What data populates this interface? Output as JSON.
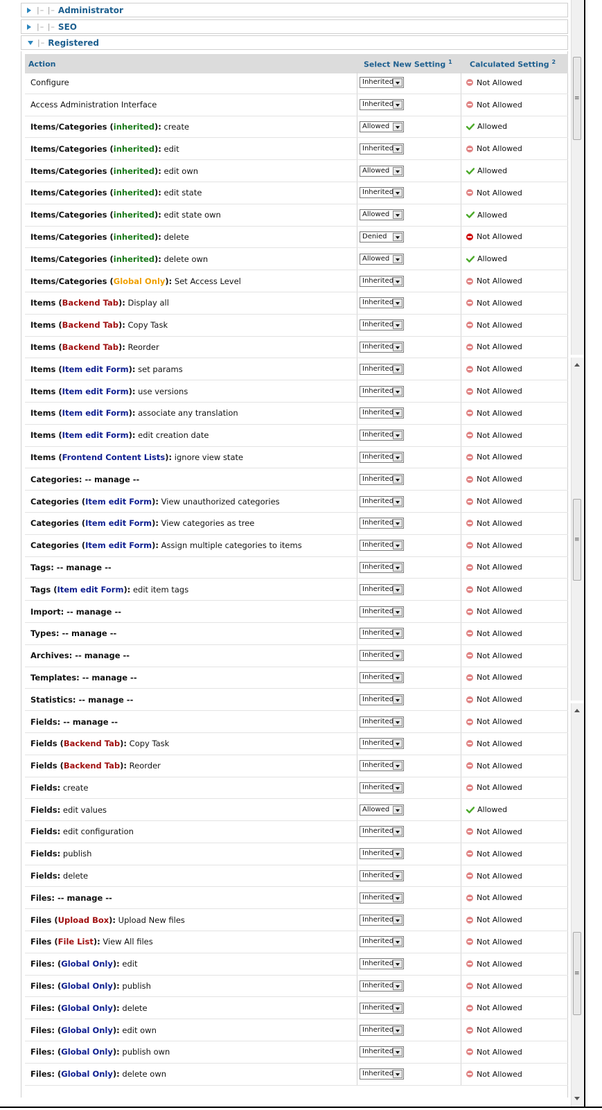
{
  "groups": {
    "administrator": "Administrator",
    "seo": "SEO",
    "registered": "Registered",
    "tree_prefix": "|– |–",
    "tree_prefix_registered": "|–"
  },
  "table": {
    "col_action": "Action",
    "col_select": "Select New Setting",
    "col_select_sup": "1",
    "col_calc": "Calculated Setting",
    "col_calc_sup": "2"
  },
  "rows": [
    {
      "pre": "Configure",
      "bold": false,
      "tag": "",
      "tagc": "",
      "post": "",
      "sel": "Inherited",
      "calc": "Not Allowed"
    },
    {
      "pre": "Access Administration Interface",
      "bold": false,
      "tag": "",
      "tagc": "",
      "post": "",
      "sel": "Inherited",
      "calc": "Not Allowed"
    },
    {
      "pre": "Items/Categories",
      "bold": true,
      "tag": "inherited",
      "tagc": "green",
      "post": ": create",
      "sel": "Allowed",
      "calc": "Allowed"
    },
    {
      "pre": "Items/Categories",
      "bold": true,
      "tag": "inherited",
      "tagc": "green",
      "post": ": edit",
      "sel": "Inherited",
      "calc": "Not Allowed"
    },
    {
      "pre": "Items/Categories",
      "bold": true,
      "tag": "inherited",
      "tagc": "green",
      "post": ": edit own",
      "sel": "Allowed",
      "calc": "Allowed"
    },
    {
      "pre": "Items/Categories",
      "bold": true,
      "tag": "inherited",
      "tagc": "green",
      "post": ": edit state",
      "sel": "Inherited",
      "calc": "Not Allowed"
    },
    {
      "pre": "Items/Categories",
      "bold": true,
      "tag": "inherited",
      "tagc": "green",
      "post": ": edit state own",
      "sel": "Allowed",
      "calc": "Allowed"
    },
    {
      "pre": "Items/Categories",
      "bold": true,
      "tag": "inherited",
      "tagc": "green",
      "post": ": delete",
      "sel": "Denied",
      "calc": "Not Allowed",
      "strong": true
    },
    {
      "pre": "Items/Categories",
      "bold": true,
      "tag": "inherited",
      "tagc": "green",
      "post": ": delete own",
      "sel": "Allowed",
      "calc": "Allowed"
    },
    {
      "pre": "Items/Categories",
      "bold": true,
      "tag": "Global Only",
      "tagc": "orange",
      "post": ": Set Access Level",
      "sel": "Inherited",
      "calc": "Not Allowed"
    },
    {
      "pre": "Items",
      "bold": true,
      "tag": "Backend Tab",
      "tagc": "red",
      "post": ": Display all",
      "sel": "Inherited",
      "calc": "Not Allowed"
    },
    {
      "pre": "Items",
      "bold": true,
      "tag": "Backend Tab",
      "tagc": "red",
      "post": ": Copy Task",
      "sel": "Inherited",
      "calc": "Not Allowed"
    },
    {
      "pre": "Items",
      "bold": true,
      "tag": "Backend Tab",
      "tagc": "red",
      "post": ": Reorder",
      "sel": "Inherited",
      "calc": "Not Allowed"
    },
    {
      "pre": "Items",
      "bold": true,
      "tag": "Item edit Form",
      "tagc": "blue",
      "post": ": set params",
      "sel": "Inherited",
      "calc": "Not Allowed"
    },
    {
      "pre": "Items",
      "bold": true,
      "tag": "Item edit Form",
      "tagc": "blue",
      "post": ": use versions",
      "sel": "Inherited",
      "calc": "Not Allowed"
    },
    {
      "pre": "Items",
      "bold": true,
      "tag": "Item edit Form",
      "tagc": "blue",
      "post": ": associate any translation",
      "sel": "Inherited",
      "calc": "Not Allowed"
    },
    {
      "pre": "Items",
      "bold": true,
      "tag": "Item edit Form",
      "tagc": "blue",
      "post": ": edit creation date",
      "sel": "Inherited",
      "calc": "Not Allowed"
    },
    {
      "pre": "Items",
      "bold": true,
      "tag": "Frontend Content Lists",
      "tagc": "blue",
      "post": ": ignore view state",
      "sel": "Inherited",
      "calc": "Not Allowed"
    },
    {
      "pre": "Categories: -- manage --",
      "bold": true,
      "tag": "",
      "tagc": "",
      "post": "",
      "sel": "Inherited",
      "calc": "Not Allowed"
    },
    {
      "pre": "Categories",
      "bold": true,
      "tag": "Item edit Form",
      "tagc": "blue",
      "post": ": View unauthorized categories",
      "sel": "Inherited",
      "calc": "Not Allowed"
    },
    {
      "pre": "Categories",
      "bold": true,
      "tag": "Item edit Form",
      "tagc": "blue",
      "post": ": View categories as tree",
      "sel": "Inherited",
      "calc": "Not Allowed"
    },
    {
      "pre": "Categories",
      "bold": true,
      "tag": "Item edit Form",
      "tagc": "blue",
      "post": ": Assign multiple categories to items",
      "sel": "Inherited",
      "calc": "Not Allowed"
    },
    {
      "pre": "Tags: -- manage --",
      "bold": true,
      "tag": "",
      "tagc": "",
      "post": "",
      "sel": "Inherited",
      "calc": "Not Allowed"
    },
    {
      "pre": "Tags",
      "bold": true,
      "tag": "Item edit Form",
      "tagc": "blue",
      "post": ": edit item tags",
      "sel": "Inherited",
      "calc": "Not Allowed"
    },
    {
      "pre": "Import: -- manage --",
      "bold": true,
      "tag": "",
      "tagc": "",
      "post": "",
      "sel": "Inherited",
      "calc": "Not Allowed"
    },
    {
      "pre": "Types: -- manage --",
      "bold": true,
      "tag": "",
      "tagc": "",
      "post": "",
      "sel": "Inherited",
      "calc": "Not Allowed"
    },
    {
      "pre": "Archives: -- manage --",
      "bold": true,
      "tag": "",
      "tagc": "",
      "post": "",
      "sel": "Inherited",
      "calc": "Not Allowed"
    },
    {
      "pre": "Templates: -- manage --",
      "bold": true,
      "tag": "",
      "tagc": "",
      "post": "",
      "sel": "Inherited",
      "calc": "Not Allowed"
    },
    {
      "pre": "Statistics: -- manage --",
      "bold": true,
      "tag": "",
      "tagc": "",
      "post": "",
      "sel": "Inherited",
      "calc": "Not Allowed"
    },
    {
      "pre": "Fields: -- manage --",
      "bold": true,
      "tag": "",
      "tagc": "",
      "post": "",
      "sel": "Inherited",
      "calc": "Not Allowed"
    },
    {
      "pre": "Fields",
      "bold": true,
      "tag": "Backend Tab",
      "tagc": "red",
      "post": ": Copy Task",
      "sel": "Inherited",
      "calc": "Not Allowed"
    },
    {
      "pre": "Fields",
      "bold": true,
      "tag": "Backend Tab",
      "tagc": "red",
      "post": ": Reorder",
      "sel": "Inherited",
      "calc": "Not Allowed"
    },
    {
      "pre": "Fields",
      "bold": true,
      "tag": "",
      "tagc": "",
      "post": ": create",
      "sel": "Inherited",
      "calc": "Not Allowed"
    },
    {
      "pre": "Fields",
      "bold": true,
      "tag": "",
      "tagc": "",
      "post": ": edit values",
      "sel": "Allowed",
      "calc": "Allowed"
    },
    {
      "pre": "Fields",
      "bold": true,
      "tag": "",
      "tagc": "",
      "post": ": edit configuration",
      "sel": "Inherited",
      "calc": "Not Allowed"
    },
    {
      "pre": "Fields",
      "bold": true,
      "tag": "",
      "tagc": "",
      "post": ": publish",
      "sel": "Inherited",
      "calc": "Not Allowed"
    },
    {
      "pre": "Fields",
      "bold": true,
      "tag": "",
      "tagc": "",
      "post": ": delete",
      "sel": "Inherited",
      "calc": "Not Allowed"
    },
    {
      "pre": "Files: -- manage --",
      "bold": true,
      "tag": "",
      "tagc": "",
      "post": "",
      "sel": "Inherited",
      "calc": "Not Allowed"
    },
    {
      "pre": "Files",
      "bold": true,
      "tag": "Upload Box",
      "tagc": "red",
      "post": ": Upload New files",
      "sel": "Inherited",
      "calc": "Not Allowed"
    },
    {
      "pre": "Files",
      "bold": true,
      "tag": "File List",
      "tagc": "red",
      "post": ": View All files",
      "sel": "Inherited",
      "calc": "Not Allowed"
    },
    {
      "pre": "Files:",
      "bold": true,
      "tag": "Global Only",
      "tagc": "blue",
      "post": ": edit",
      "sel": "Inherited",
      "calc": "Not Allowed"
    },
    {
      "pre": "Files:",
      "bold": true,
      "tag": "Global Only",
      "tagc": "blue",
      "post": ": publish",
      "sel": "Inherited",
      "calc": "Not Allowed"
    },
    {
      "pre": "Files:",
      "bold": true,
      "tag": "Global Only",
      "tagc": "blue",
      "post": ": delete",
      "sel": "Inherited",
      "calc": "Not Allowed"
    },
    {
      "pre": "Files:",
      "bold": true,
      "tag": "Global Only",
      "tagc": "blue",
      "post": ": edit own",
      "sel": "Inherited",
      "calc": "Not Allowed"
    },
    {
      "pre": "Files:",
      "bold": true,
      "tag": "Global Only",
      "tagc": "blue",
      "post": ": publish own",
      "sel": "Inherited",
      "calc": "Not Allowed"
    },
    {
      "pre": "Files:",
      "bold": true,
      "tag": "Global Only",
      "tagc": "blue",
      "post": ": delete own",
      "sel": "Inherited",
      "calc": "Not Allowed"
    }
  ],
  "colors": {
    "header_text": "#1d5f8f",
    "inherited": "#1a7a1a",
    "global_only": "#f0a000",
    "backend_tab": "#a01010",
    "item_edit_form": "#102090"
  }
}
